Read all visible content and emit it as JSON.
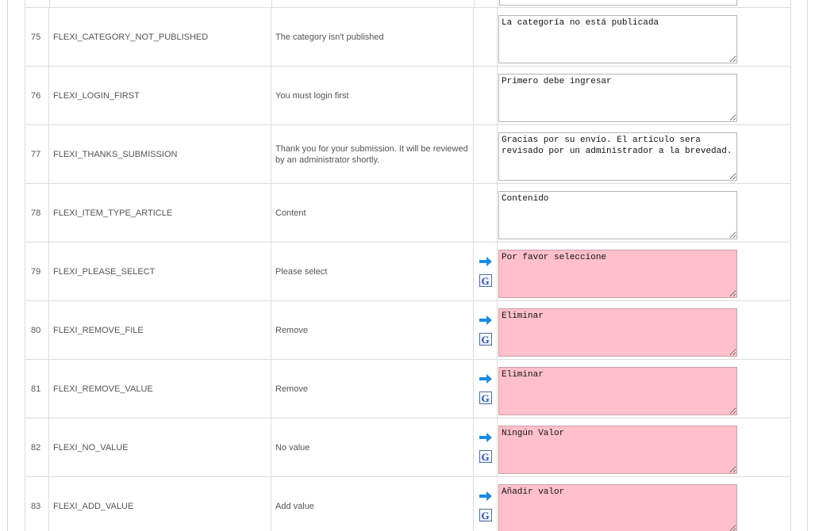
{
  "rows": [
    {
      "num": "75",
      "key": "FLEXI_CATEGORY_NOT_PUBLISHED",
      "original": "The category isn't published",
      "translation": "La categoría no está publicada",
      "untranslated": false
    },
    {
      "num": "76",
      "key": "FLEXI_LOGIN_FIRST",
      "original": "You must login first",
      "translation": "Primero debe ingresar",
      "untranslated": false
    },
    {
      "num": "77",
      "key": "FLEXI_THANKS_SUBMISSION",
      "original": "Thank you for your submission. It will be reviewed by an administrator shortly.",
      "translation": "Gracias por su envío. El artículo sera revisado por un administrador a la brevedad.",
      "untranslated": false
    },
    {
      "num": "78",
      "key": "FLEXI_ITEM_TYPE_ARTICLE",
      "original": "Content",
      "translation": "Contenido",
      "untranslated": false
    },
    {
      "num": "79",
      "key": "FLEXI_PLEASE_SELECT",
      "original": "Please select",
      "translation": "Por favor seleccione",
      "untranslated": true
    },
    {
      "num": "80",
      "key": "FLEXI_REMOVE_FILE",
      "original": "Remove",
      "translation": "Eliminar",
      "untranslated": true
    },
    {
      "num": "81",
      "key": "FLEXI_REMOVE_VALUE",
      "original": "Remove",
      "translation": "Eliminar",
      "untranslated": true
    },
    {
      "num": "82",
      "key": "FLEXI_NO_VALUE",
      "original": "No value",
      "translation": "Ningún Valor",
      "untranslated": true
    },
    {
      "num": "83",
      "key": "FLEXI_ADD_VALUE",
      "original": "Add value",
      "translation": "Añadir valor",
      "untranslated": true
    }
  ],
  "icons": {
    "copy": "arrow-right-icon",
    "google_translate": "google-translate-icon",
    "google_glyph": "G"
  },
  "colors": {
    "untranslated_bg": "#ffc0cb",
    "arrow_blue": "#1a8ce0"
  }
}
